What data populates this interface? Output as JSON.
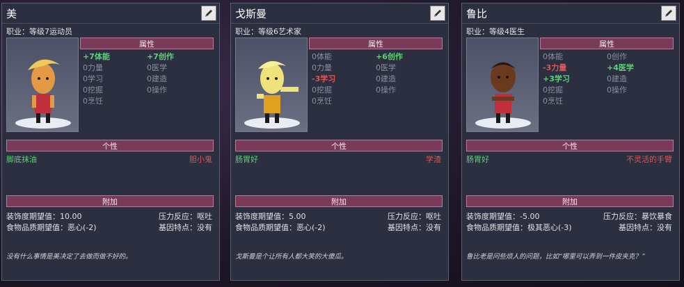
{
  "section_labels": {
    "attributes": "属性",
    "traits": "个性",
    "extra": "附加"
  },
  "attr_names": [
    "体能",
    "力量",
    "学习",
    "挖掘",
    "烹饪",
    "创作",
    "医学",
    "建造",
    "操作"
  ],
  "cards": [
    {
      "name": "美",
      "job": "职业：等级7运动员",
      "attributes": [
        {
          "value": "+7",
          "label": "体能",
          "kind": "pos"
        },
        {
          "value": "+7",
          "label": "创作",
          "kind": "pos"
        },
        {
          "value": "0",
          "label": "力量",
          "kind": "zero"
        },
        {
          "value": "0",
          "label": "医学",
          "kind": "zero"
        },
        {
          "value": "0",
          "label": "学习",
          "kind": "zero"
        },
        {
          "value": "0",
          "label": "建造",
          "kind": "zero"
        },
        {
          "value": "0",
          "label": "挖掘",
          "kind": "zero"
        },
        {
          "value": "0",
          "label": "操作",
          "kind": "zero"
        },
        {
          "value": "0",
          "label": "烹饪",
          "kind": "zero"
        }
      ],
      "trait_good": "脚底抹油",
      "trait_bad": "胆小鬼",
      "decor_label": "装饰度期望值：10.00",
      "stress_label": "压力反应：呕吐",
      "food_label": "食物品质期望值：恶心(-2)",
      "gene_label": "基因特点：没有",
      "description": "没有什么事情是美决定了去做而做不好的。"
    },
    {
      "name": "戈斯曼",
      "job": "职业：等级6艺术家",
      "attributes": [
        {
          "value": "0",
          "label": "体能",
          "kind": "zero"
        },
        {
          "value": "+6",
          "label": "创作",
          "kind": "pos"
        },
        {
          "value": "0",
          "label": "力量",
          "kind": "zero"
        },
        {
          "value": "0",
          "label": "医学",
          "kind": "zero"
        },
        {
          "value": "-3",
          "label": "学习",
          "kind": "neg"
        },
        {
          "value": "0",
          "label": "建造",
          "kind": "zero"
        },
        {
          "value": "0",
          "label": "挖掘",
          "kind": "zero"
        },
        {
          "value": "0",
          "label": "操作",
          "kind": "zero"
        },
        {
          "value": "0",
          "label": "烹饪",
          "kind": "zero"
        }
      ],
      "trait_good": "肠胃好",
      "trait_bad": "学渣",
      "decor_label": "装饰度期望值：5.00",
      "stress_label": "压力反应：呕吐",
      "food_label": "食物品质期望值：恶心(-2)",
      "gene_label": "基因特点：没有",
      "description": "戈斯曼是个让所有人都大笑的大傻瓜。"
    },
    {
      "name": "鲁比",
      "job": "职业：等级4医生",
      "attributes": [
        {
          "value": "0",
          "label": "体能",
          "kind": "zero"
        },
        {
          "value": "0",
          "label": "创作",
          "kind": "zero"
        },
        {
          "value": "-3",
          "label": "力量",
          "kind": "neg"
        },
        {
          "value": "+4",
          "label": "医学",
          "kind": "pos"
        },
        {
          "value": "+3",
          "label": "学习",
          "kind": "pos"
        },
        {
          "value": "0",
          "label": "建造",
          "kind": "zero"
        },
        {
          "value": "0",
          "label": "挖掘",
          "kind": "zero"
        },
        {
          "value": "0",
          "label": "操作",
          "kind": "zero"
        },
        {
          "value": "0",
          "label": "烹饪",
          "kind": "zero"
        }
      ],
      "trait_good": "肠胃好",
      "trait_bad": "不灵活的手臂",
      "decor_label": "装饰度期望值：-5.00",
      "stress_label": "压力反应：暴饮暴食",
      "food_label": "食物品质期望值：极其恶心(-3)",
      "gene_label": "基因特点：没有",
      "description": "鲁比老是问些烦人的问题，比如“哪里可以弄到一件皮夹克？”"
    }
  ]
}
